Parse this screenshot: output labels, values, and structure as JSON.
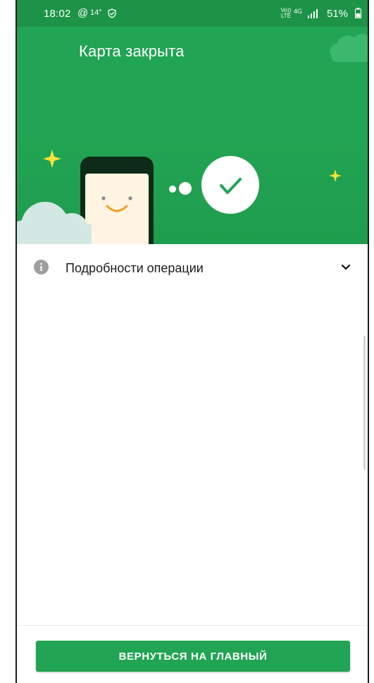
{
  "status_bar": {
    "time": "18:02",
    "at_icon": "@",
    "temperature": "14°",
    "shield_icon": "shield-check-icon",
    "volte": "Vo)) LTE",
    "network": "4G",
    "battery_percent": "51%"
  },
  "hero": {
    "title": "Карта закрыта",
    "illustration": "phone-smiley-checkmark-illustration"
  },
  "details": {
    "label": "Подробности операции",
    "icon": "info-icon",
    "expand_icon": "chevron-down-icon"
  },
  "actions": {
    "primary_label": "ВЕРНУТЬСЯ НА ГЛАВНЫЙ"
  },
  "colors": {
    "brand_green": "#21a453",
    "status_green": "#1c9347",
    "dark_green": "#0e2a18",
    "star_yellow": "#f7e33a",
    "cloud": "#d4e8e3",
    "smile": "#f59a23",
    "phone_screen": "#fef4e1"
  }
}
